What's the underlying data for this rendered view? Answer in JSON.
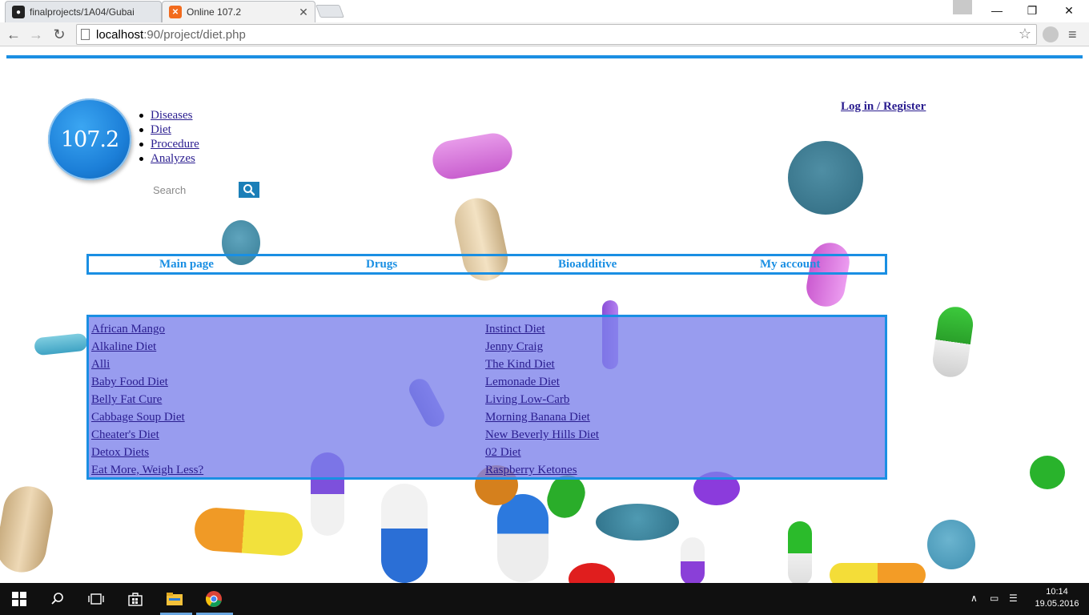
{
  "browser": {
    "tabs": [
      {
        "title": "finalprojects/1A04/Gubai",
        "favicon": "github-icon"
      },
      {
        "title": "Online 107.2",
        "favicon": "xampp-icon"
      }
    ],
    "url_host": "localhost",
    "url_rest": ":90/project/diet.php"
  },
  "site": {
    "logo_text": "107.2",
    "side_nav": [
      "Diseases",
      "Diet",
      "Procedure",
      "Analyzes"
    ],
    "search_placeholder": "Search",
    "login_label": "Log in",
    "login_sep": " / ",
    "register_label": "Register",
    "main_nav": [
      "Main page",
      "Drugs",
      "Bioadditive",
      "My account"
    ],
    "diets_left": [
      "African Mango",
      "Alkaline Diet",
      "Alli",
      "Baby Food Diet",
      "Belly Fat Cure",
      "Cabbage Soup Diet",
      "Cheater's Diet",
      "Detox Diets",
      "Eat More, Weigh Less?"
    ],
    "diets_right": [
      "Instinct Diet",
      "Jenny Craig",
      "The Kind Diet",
      "Lemonade Diet",
      "Living Low-Carb",
      "Morning Banana Diet",
      "New Beverly Hills Diet",
      "02 Diet",
      "Raspberry Ketones"
    ]
  },
  "taskbar": {
    "time": "10:14",
    "date": "19.05.2016"
  },
  "colors": {
    "accent": "#1a8fe3",
    "diet_panel": "#7b80ea",
    "link": "#2a1d8f"
  }
}
